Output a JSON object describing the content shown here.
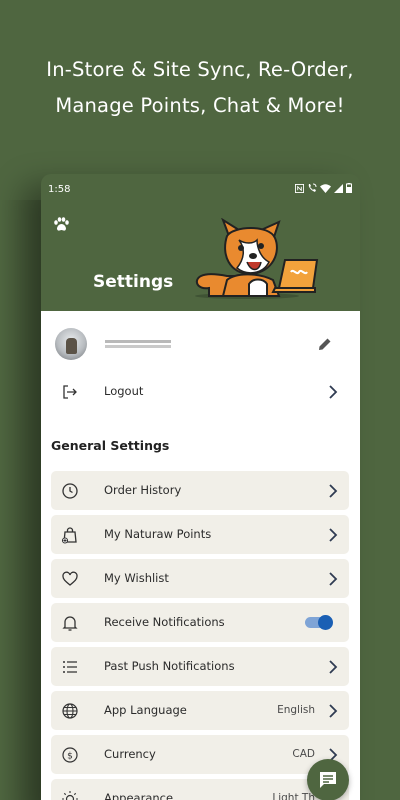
{
  "promo": {
    "line1": "In-Store & Site Sync, Re-Order,",
    "line2": "Manage Points, Chat & More!"
  },
  "status_bar": {
    "time": "1:58",
    "icons": [
      "nfc-icon",
      "wifi-calling-icon",
      "wifi-icon",
      "signal-icon",
      "battery-icon"
    ]
  },
  "header": {
    "title": "Settings",
    "icon": "paw-icon"
  },
  "profile": {
    "avatar": "avatar",
    "edit_icon": "pencil-icon"
  },
  "logout": {
    "label": "Logout",
    "icon": "logout-icon"
  },
  "general_settings": {
    "title": "General Settings",
    "items": [
      {
        "label": "Order History",
        "icon": "clock-icon",
        "value": ""
      },
      {
        "label": "My Naturaw Points",
        "icon": "shopping-bag-icon",
        "value": ""
      },
      {
        "label": "My Wishlist",
        "icon": "heart-icon",
        "value": ""
      },
      {
        "label": "Receive Notifications",
        "icon": "bell-icon",
        "toggle": true
      },
      {
        "label": "Past Push Notifications",
        "icon": "list-icon",
        "value": ""
      },
      {
        "label": "App Language",
        "icon": "globe-icon",
        "value": "English"
      },
      {
        "label": "Currency",
        "icon": "dollar-icon",
        "value": "CAD"
      },
      {
        "label": "Appearance",
        "icon": "sun-icon",
        "value": "Light Th"
      }
    ]
  },
  "colors": {
    "brand_green": "#4f6640",
    "card_bg": "#f1efe8",
    "toggle_on": "#1a5fb4"
  },
  "chat_button": {
    "icon": "chat-icon"
  }
}
